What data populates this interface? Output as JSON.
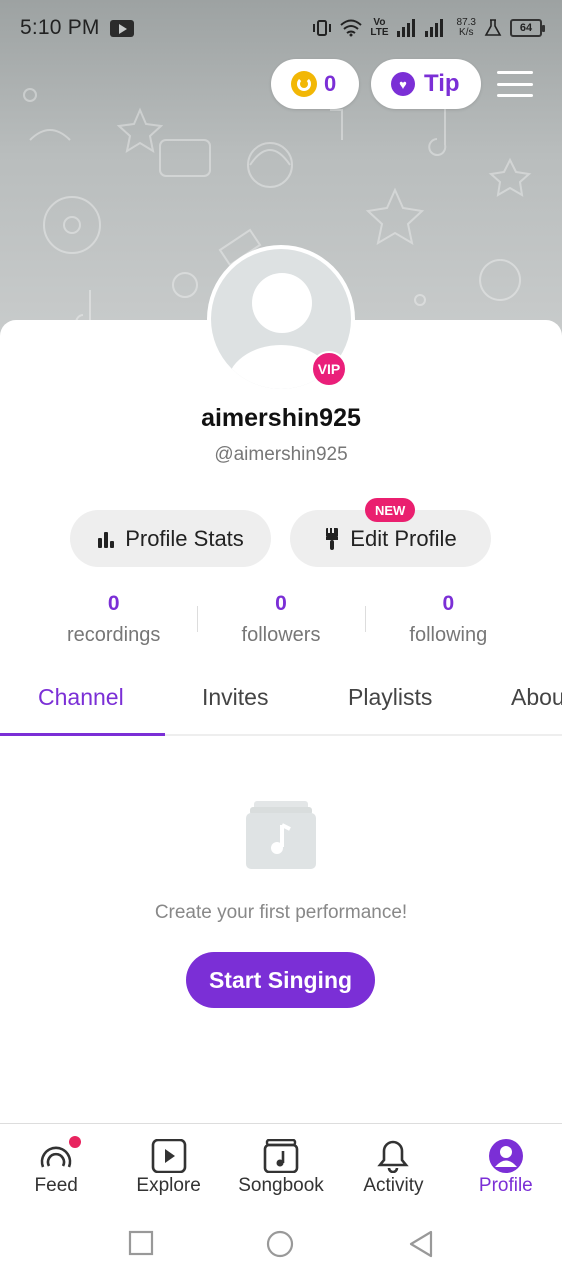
{
  "status_bar": {
    "time": "5:10 PM",
    "speed_value": "87.3",
    "speed_unit": "K/s",
    "battery": "64",
    "network_label_top": "Vo",
    "network_label_bottom": "LTE"
  },
  "header": {
    "coins": "0",
    "tip_label": "Tip"
  },
  "profile": {
    "display_name": "aimershin925",
    "handle": "@aimershin925",
    "vip_label": "VIP",
    "stats_button": "Profile Stats",
    "edit_button": "Edit Profile",
    "new_badge": "NEW"
  },
  "stats": [
    {
      "value": "0",
      "label": "recordings"
    },
    {
      "value": "0",
      "label": "followers"
    },
    {
      "value": "0",
      "label": "following"
    }
  ],
  "tabs": [
    {
      "label": "Channel",
      "active": true
    },
    {
      "label": "Invites",
      "active": false
    },
    {
      "label": "Playlists",
      "active": false
    },
    {
      "label": "About",
      "active": false
    }
  ],
  "empty_state": {
    "message": "Create your first performance!",
    "cta": "Start Singing"
  },
  "bottom_nav": [
    {
      "label": "Feed",
      "icon": "feed-icon"
    },
    {
      "label": "Explore",
      "icon": "explore-icon"
    },
    {
      "label": "Songbook",
      "icon": "songbook-icon"
    },
    {
      "label": "Activity",
      "icon": "bell-icon"
    },
    {
      "label": "Profile",
      "icon": "profile-icon",
      "active": true
    }
  ],
  "colors": {
    "accent": "#7b2fd6",
    "vip": "#ea1f7a",
    "coin": "#f2b705"
  }
}
